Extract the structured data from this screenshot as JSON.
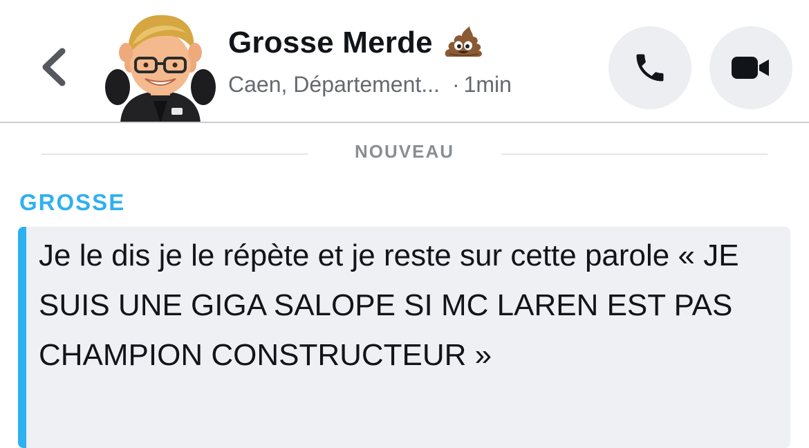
{
  "header": {
    "title": "Grosse Merde",
    "title_emoji_icon": "poop-emoji-icon",
    "location": "Caen, Département...",
    "separator": "·",
    "time_ago": "1min",
    "back_icon": "chevron-left-icon",
    "call_icon": "phone-icon",
    "video_icon": "video-camera-icon",
    "avatar": "bitmoji-avatar"
  },
  "divider": {
    "label": "NOUVEAU"
  },
  "message": {
    "sender": "GROSSE",
    "text": "Je le dis je le répète et je reste sur cette parole « JE SUIS UNE GIGA SALOPE SI MC LAREN EST PAS CHAMPION CONSTRUCTEUR »"
  },
  "colors": {
    "accent": "#2fb0f0",
    "title": "#111418",
    "subtitle": "#65696e",
    "button_bg": "#eceef1",
    "message_bg": "#eef0f3"
  }
}
